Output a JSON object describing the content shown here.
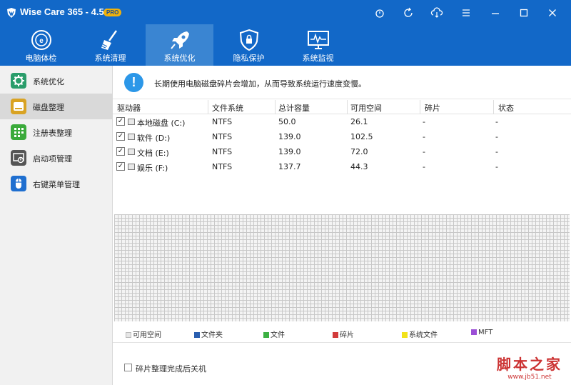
{
  "titlebar": {
    "title": "Wise Care 365 - 4.51",
    "badge": "PRO",
    "buttons": [
      "timer-icon",
      "refresh-icon",
      "cloud-sync-icon",
      "menu-icon",
      "minimize-icon",
      "maximize-icon",
      "close-icon"
    ]
  },
  "topnav": {
    "items": [
      {
        "label": "电脑体检",
        "icon": "scan-icon"
      },
      {
        "label": "系统清理",
        "icon": "broom-icon"
      },
      {
        "label": "系统优化",
        "icon": "rocket-icon",
        "active": true
      },
      {
        "label": "隐私保护",
        "icon": "shield-icon"
      },
      {
        "label": "系统监视",
        "icon": "monitor-icon"
      }
    ]
  },
  "sidebar": {
    "items": [
      {
        "label": "系统优化",
        "icon": "gear-icon",
        "color": "#2a9d6b"
      },
      {
        "label": "磁盘整理",
        "icon": "disk-icon",
        "color": "#d9a323",
        "active": true
      },
      {
        "label": "注册表整理",
        "icon": "registry-icon",
        "color": "#3aaa3a"
      },
      {
        "label": "启动项管理",
        "icon": "startup-icon",
        "color": "#555555"
      },
      {
        "label": "右键菜单管理",
        "icon": "mouse-icon",
        "color": "#1f6fd0"
      }
    ]
  },
  "banner": {
    "message": "长期使用电脑磁盘碎片会增加，从而导致系统运行速度变慢。"
  },
  "table": {
    "headers": [
      "驱动器",
      "文件系统",
      "总计容量",
      "可用空间",
      "碎片",
      "状态"
    ],
    "rows": [
      {
        "checked": true,
        "drive": "本地磁盘 (C:)",
        "fs": "NTFS",
        "total": "50.0",
        "free": "26.1",
        "frag": "-",
        "status": "-"
      },
      {
        "checked": true,
        "drive": "软件 (D:)",
        "fs": "NTFS",
        "total": "139.0",
        "free": "102.5",
        "frag": "-",
        "status": "-"
      },
      {
        "checked": true,
        "drive": "文档 (E:)",
        "fs": "NTFS",
        "total": "139.0",
        "free": "72.0",
        "frag": "-",
        "status": "-"
      },
      {
        "checked": true,
        "drive": "娱乐 (F:)",
        "fs": "NTFS",
        "total": "137.7",
        "free": "44.3",
        "frag": "-",
        "status": "-"
      }
    ]
  },
  "legend": [
    {
      "label": "可用空间",
      "color": "#e6e6e6"
    },
    {
      "label": "文件夹",
      "color": "#2a5fb0"
    },
    {
      "label": "文件",
      "color": "#3cb043"
    },
    {
      "label": "碎片",
      "color": "#d23b3b"
    },
    {
      "label": "系统文件",
      "color": "#f2e21a"
    },
    {
      "label": "MFT",
      "color": "#9b4fd6"
    }
  ],
  "options": {
    "shutdown_label": "碎片整理完成后关机",
    "shutdown_checked": false
  },
  "watermark": {
    "line1": "脚本之家",
    "line2": "www.jb51.net"
  }
}
